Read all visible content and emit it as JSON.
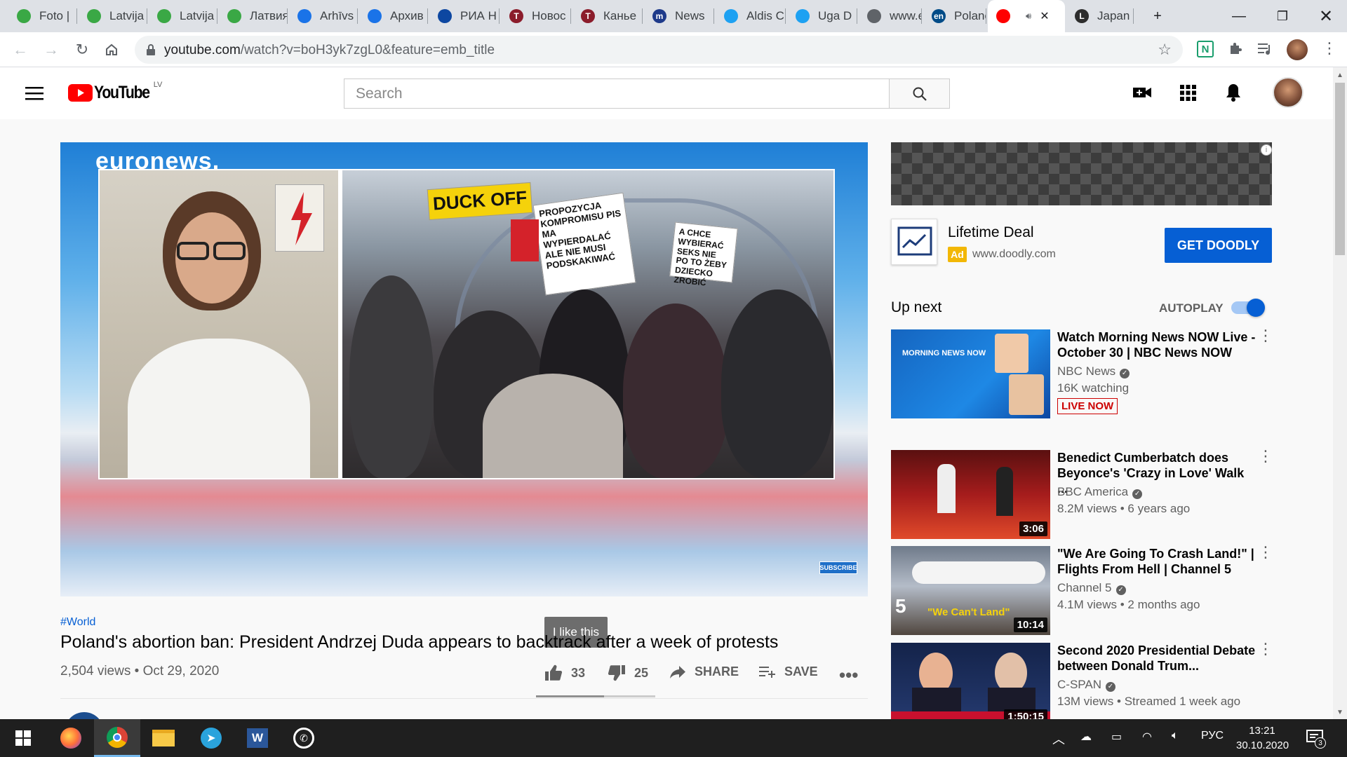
{
  "browser": {
    "tabs": [
      {
        "label": "Foto |",
        "fav_color": "#3aa845",
        "fav_text": ""
      },
      {
        "label": "Latvija",
        "fav_color": "#3aa845",
        "fav_text": ""
      },
      {
        "label": "Latvija",
        "fav_color": "#3aa845",
        "fav_text": ""
      },
      {
        "label": "Латвия",
        "fav_color": "#3aa845",
        "fav_text": ""
      },
      {
        "label": "Arhīvs",
        "fav_color": "#1a73e8",
        "fav_text": ""
      },
      {
        "label": "Архив",
        "fav_color": "#1a73e8",
        "fav_text": ""
      },
      {
        "label": "РИА Н",
        "fav_color": "#0d47a1",
        "fav_text": ""
      },
      {
        "label": "Новос",
        "fav_color": "#8b1c2b",
        "fav_text": "T"
      },
      {
        "label": "Канье",
        "fav_color": "#8b1c2b",
        "fav_text": "T"
      },
      {
        "label": "News",
        "fav_color": "#1e3a8a",
        "fav_text": "m"
      },
      {
        "label": "Aldis C",
        "fav_color": "#1da1f2",
        "fav_text": ""
      },
      {
        "label": "Uga D",
        "fav_color": "#1da1f2",
        "fav_text": ""
      },
      {
        "label": "www.e",
        "fav_color": "#5f6368",
        "fav_text": ""
      },
      {
        "label": "Polanc",
        "fav_color": "#004b87",
        "fav_text": "en"
      },
      {
        "label": "",
        "fav_color": "#ff0000",
        "fav_text": ""
      },
      {
        "label": "Japan",
        "fav_color": "#2d2d2d",
        "fav_text": "L"
      }
    ],
    "new_tab": "+",
    "url_host": "youtube.com",
    "url_path": "/watch?v=boH3yk7zgL0&feature=emb_title"
  },
  "youtube": {
    "logo_text": "YouTube",
    "region": "LV",
    "search_placeholder": "Search"
  },
  "player": {
    "watermark": "euronews.",
    "signs": [
      "DUCK OFF",
      "PROPOZYCJA KOMPROMISU PIS MA WYPIERDALAĆ ALE NIE MUSI PODSKAKIWAĆ",
      "A CHCE WYBIERAĆ SEKS NIE PO TO ŻEBY DZIECKO ZROBIĆ"
    ],
    "subscribe_badge": "SUBSCRIBE",
    "tooltip": "I like this"
  },
  "video": {
    "hashtag": "#World",
    "title": "Poland's abortion ban: President Andrzej Duda appears to backtrack after a week of protests",
    "views": "2,504 views",
    "date": "Oct 29, 2020",
    "likes": "33",
    "dislikes": "25",
    "share_label": "SHARE",
    "save_label": "SAVE",
    "like_ratio": 0.57
  },
  "ad": {
    "title": "Lifetime Deal",
    "badge": "Ad",
    "url": "www.doodly.com",
    "cta": "GET DOODLY"
  },
  "sidebar": {
    "up_next": "Up next",
    "autoplay_label": "AUTOPLAY",
    "autoplay_on": true,
    "videos": [
      {
        "title": "Watch Morning News NOW Live - October 30 | NBC News NOW",
        "channel": "NBC News",
        "stats": "16K watching",
        "badge": "LIVE NOW",
        "duration": "",
        "thumb_text": "MORNING NEWS NOW"
      },
      {
        "title": "Benedict Cumberbatch does Beyonce's 'Crazy in Love' Walk ...",
        "channel": "BBC America",
        "stats": "8.2M views • 6 years ago",
        "badge": "",
        "duration": "3:06",
        "thumb_text": ""
      },
      {
        "title": "\"We Are Going To Crash Land!\" | Flights From Hell | Channel 5",
        "channel": "Channel 5",
        "stats": "4.1M views • 2 months ago",
        "badge": "",
        "duration": "10:14",
        "thumb_text": "\"We Can't Land\""
      },
      {
        "title": "Second 2020 Presidential Debate between Donald Trum...",
        "channel": "C-SPAN",
        "stats": "13M views • Streamed 1 week ago",
        "badge": "",
        "duration": "1:50:15",
        "thumb_text": ""
      }
    ]
  },
  "taskbar": {
    "language": "РУС",
    "time": "13:21",
    "date": "30.10.2020",
    "notifications": "3"
  }
}
